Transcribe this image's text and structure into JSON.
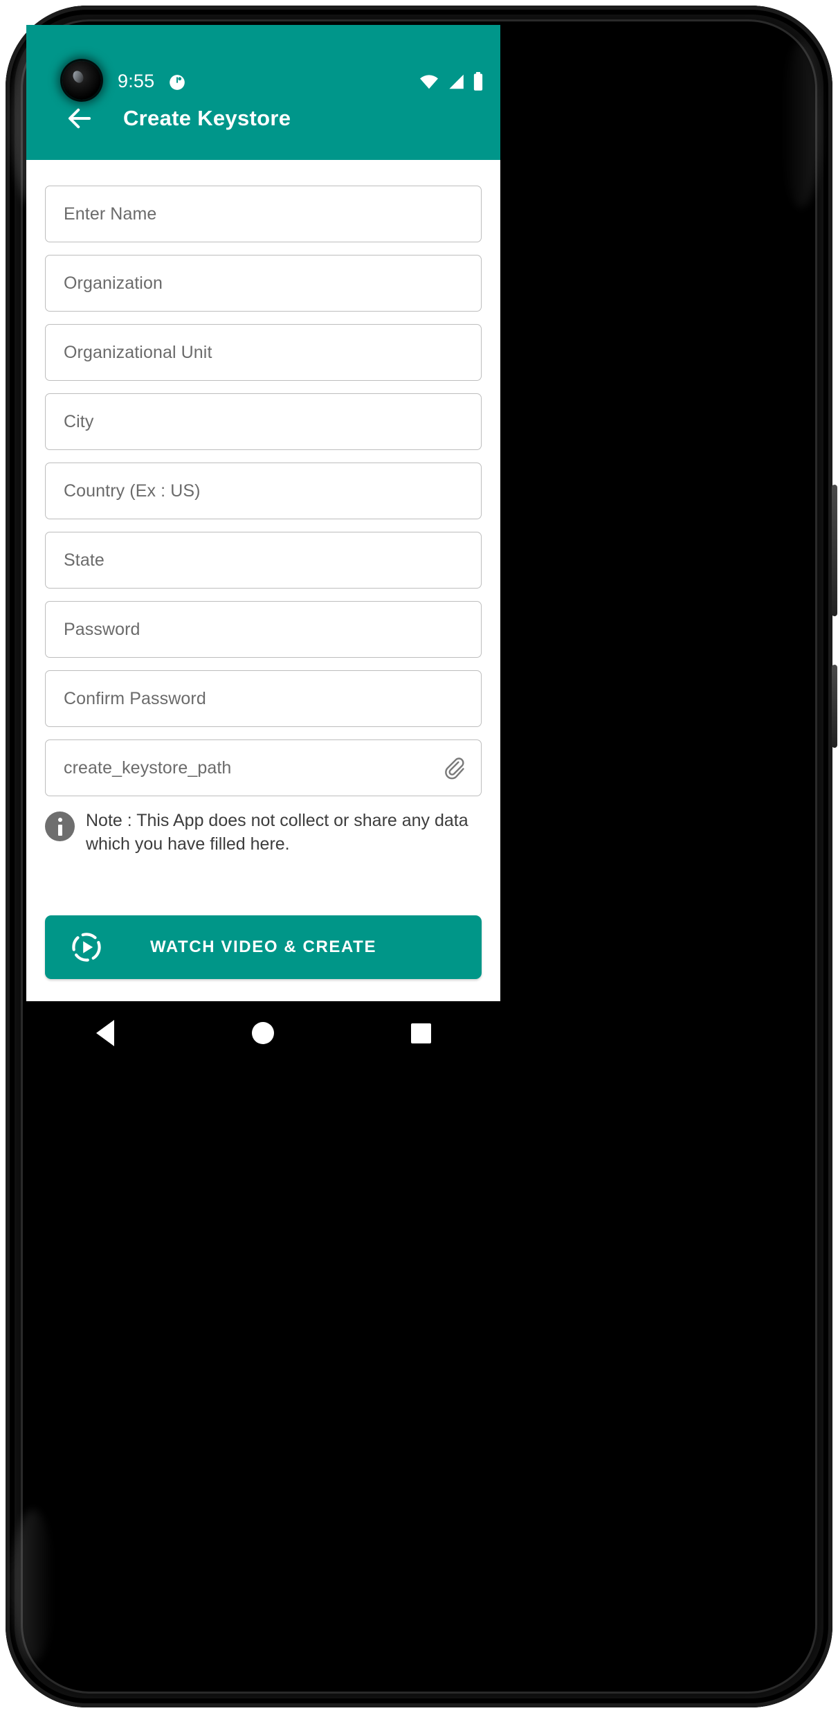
{
  "status_bar": {
    "time": "9:55",
    "badge_icon": "clock-badge-icon",
    "wifi_icon": "wifi-icon",
    "signal_icon": "cellular-signal-icon",
    "battery_icon": "battery-full-icon"
  },
  "app_bar": {
    "back_icon": "back-arrow-icon",
    "title": "Create Keystore",
    "background_color": "#00968a"
  },
  "form": {
    "fields": [
      {
        "name": "name",
        "placeholder": "Enter Name",
        "value": "",
        "has_attachment": false
      },
      {
        "name": "organization",
        "placeholder": "Organization",
        "value": "",
        "has_attachment": false
      },
      {
        "name": "organizational-unit",
        "placeholder": "Organizational Unit",
        "value": "",
        "has_attachment": false
      },
      {
        "name": "city",
        "placeholder": "City",
        "value": "",
        "has_attachment": false
      },
      {
        "name": "country",
        "placeholder": "Country (Ex : US)",
        "value": "",
        "has_attachment": false
      },
      {
        "name": "state",
        "placeholder": "State",
        "value": "",
        "has_attachment": false
      },
      {
        "name": "password",
        "placeholder": "Password",
        "value": "",
        "has_attachment": false
      },
      {
        "name": "confirm-password",
        "placeholder": "Confirm Password",
        "value": "",
        "has_attachment": false
      },
      {
        "name": "keystore-path",
        "placeholder": "create_keystore_path",
        "value": "",
        "has_attachment": true,
        "attachment_icon": "paperclip-icon"
      }
    ]
  },
  "note": {
    "icon": "info-icon",
    "text": "Note : This App does not collect or share any data which you have filled here."
  },
  "cta": {
    "icon": "play-circle-icon",
    "label": "WATCH VIDEO & CREATE",
    "background_color": "#009688"
  },
  "nav_bar": {
    "back_label": "back-triangle-icon",
    "home_label": "home-circle-icon",
    "recents_label": "recents-square-icon"
  }
}
